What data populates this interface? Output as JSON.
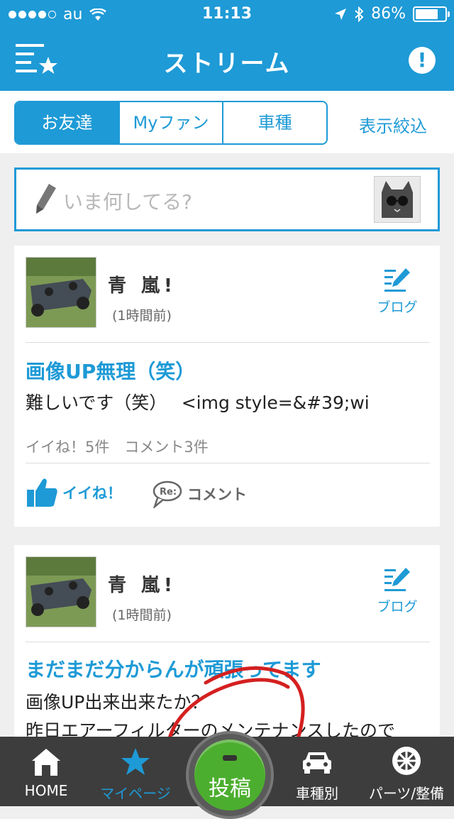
{
  "status_bar": {
    "carrier": "au",
    "time": "11:13",
    "battery": "86%",
    "battery_level": 0.86
  },
  "header": {
    "title": "ストリーム",
    "menu_icon": "menu-star-icon",
    "info_icon": "info-icon"
  },
  "segments": {
    "items": [
      "お友達",
      "Myファン",
      "車種"
    ],
    "active_index": 0,
    "filter_label": "表示絞込"
  },
  "compose": {
    "placeholder": "いま何してる?"
  },
  "posts": [
    {
      "author": "青 嵐!",
      "time": "(1時間前)",
      "blog_label": "ブログ",
      "title": "画像UP無理（笑）",
      "body_lines": [
        "難しいです（笑）　 <img style=&#39;wi"
      ],
      "stats": "イイね！5件　コメント3件",
      "like_label": "イイね！",
      "comment_label": "コメント"
    },
    {
      "author": "青 嵐!",
      "time": "(1時間前)",
      "blog_label": "ブログ",
      "title": "まだまだ分からんが頑張ってます",
      "body_lines": [
        "画像UP出来出来たか？",
        "昨日エアーフィルターのメンテナンスしたので"
      ]
    }
  ],
  "tab_bar": {
    "home": "HOME",
    "mypage": "マイページ",
    "post": "投稿",
    "car_type": "車種別",
    "parts": "パーツ/整備"
  },
  "colors": {
    "accent": "#1e9ad6",
    "tab_bar": "#3d3d3d",
    "post_button": "#4cae2e"
  }
}
